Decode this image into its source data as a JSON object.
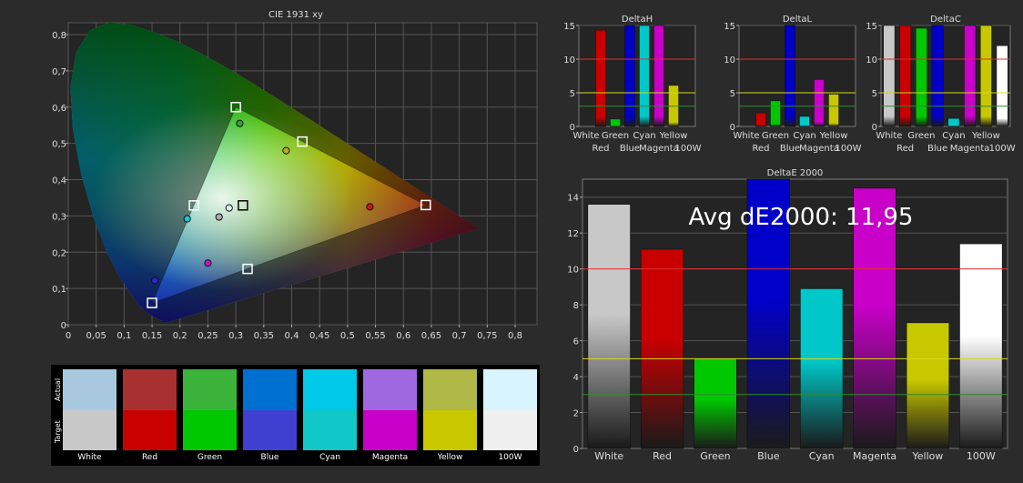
{
  "colors": {
    "background": "#2b2b2b",
    "plot_bg": "#242424",
    "grid": "#555555",
    "red_line": "#e03030",
    "yellow_line": "#d8d820",
    "green_line": "#2e8b2e"
  },
  "chart_data": [
    {
      "id": "cie",
      "type": "scatter",
      "title": "CIE 1931 xy",
      "xlim": [
        0,
        0.8
      ],
      "ylim": [
        0,
        0.8
      ],
      "x_ticks": [
        "0",
        "0,05",
        "0,1",
        "0,15",
        "0,2",
        "0,25",
        "0,3",
        "0,35",
        "0,4",
        "0,45",
        "0,5",
        "0,55",
        "0,6",
        "0,65",
        "0,7",
        "0,75",
        "0,8"
      ],
      "y_ticks": [
        "0",
        "0,1",
        "0,2",
        "0,3",
        "0,4",
        "0,5",
        "0,6",
        "0,7",
        "0,8"
      ],
      "target_points": [
        {
          "x": 0.64,
          "y": 0.33
        },
        {
          "x": 0.3,
          "y": 0.6
        },
        {
          "x": 0.15,
          "y": 0.06
        },
        {
          "x": 0.225,
          "y": 0.329
        },
        {
          "x": 0.321,
          "y": 0.154
        },
        {
          "x": 0.419,
          "y": 0.505
        },
        {
          "x": 0.3127,
          "y": 0.329
        }
      ],
      "measured_points": [
        {
          "x": 0.54,
          "y": 0.325,
          "color": "#c81818"
        },
        {
          "x": 0.307,
          "y": 0.555,
          "color": "#28a828"
        },
        {
          "x": 0.155,
          "y": 0.122,
          "color": "#2a2ad0"
        },
        {
          "x": 0.213,
          "y": 0.292,
          "color": "#18c8c8"
        },
        {
          "x": 0.25,
          "y": 0.17,
          "color": "#c018c0"
        },
        {
          "x": 0.39,
          "y": 0.48,
          "color": "#b0b020"
        },
        {
          "x": 0.27,
          "y": 0.297,
          "color": "#aaaaaa"
        },
        {
          "x": 0.288,
          "y": 0.322,
          "color": "#e0f0ff"
        }
      ]
    },
    {
      "id": "deltah",
      "type": "bar",
      "title": "DeltaH",
      "ylim": [
        0,
        15
      ],
      "y_ticks": [
        "0",
        "5",
        "10",
        "15"
      ],
      "categories_row1": [
        "White",
        "Green",
        "Cyan",
        "Yellow"
      ],
      "categories_row2": [
        "Red",
        "Blue",
        "Magenta",
        "100W"
      ],
      "values": [
        0,
        14.3,
        1.1,
        15,
        15,
        15,
        6.1,
        0
      ],
      "bar_colors": [
        "#c8c8c8",
        "#c80000",
        "#00c800",
        "#0000c8",
        "#00c8c8",
        "#c800c8",
        "#c8c800",
        "#ffffff"
      ],
      "thresholds": [
        10,
        5,
        3
      ]
    },
    {
      "id": "deltal",
      "type": "bar",
      "title": "DeltaL",
      "ylim": [
        0,
        15
      ],
      "y_ticks": [
        "0",
        "5",
        "10",
        "15"
      ],
      "categories_row1": [
        "White",
        "Green",
        "Cyan",
        "Yellow"
      ],
      "categories_row2": [
        "Red",
        "Blue",
        "Magenta",
        "100W"
      ],
      "values": [
        0,
        2,
        3.8,
        15,
        1.5,
        7,
        4.8,
        0
      ],
      "bar_colors": [
        "#c8c8c8",
        "#c80000",
        "#00c800",
        "#0000c8",
        "#00c8c8",
        "#c800c8",
        "#c8c800",
        "#ffffff"
      ],
      "thresholds": [
        10,
        5,
        3
      ]
    },
    {
      "id": "deltac",
      "type": "bar",
      "title": "DeltaC",
      "ylim": [
        0,
        15
      ],
      "y_ticks": [
        "0",
        "5",
        "10",
        "15"
      ],
      "categories_row1": [
        "White",
        "Green",
        "Cyan",
        "Yellow"
      ],
      "categories_row2": [
        "Red",
        "Blue",
        "Magenta",
        "100W"
      ],
      "values": [
        15,
        15,
        14.6,
        15,
        1.2,
        15,
        15,
        12
      ],
      "bar_colors": [
        "#c8c8c8",
        "#c80000",
        "#00c800",
        "#0000c8",
        "#00c8c8",
        "#c800c8",
        "#c8c800",
        "#ffffff"
      ],
      "thresholds": [
        10,
        5,
        3
      ]
    },
    {
      "id": "deltae",
      "type": "bar",
      "title": "DeltaE 2000",
      "annotation": "Avg dE2000: 11,95",
      "ylim": [
        0,
        15
      ],
      "y_ticks": [
        "0",
        "2",
        "4",
        "6",
        "8",
        "10",
        "12",
        "14"
      ],
      "categories": [
        "White",
        "Red",
        "Green",
        "Blue",
        "Cyan",
        "Magenta",
        "Yellow",
        "100W"
      ],
      "values": [
        13.6,
        11.1,
        5.0,
        15.0,
        8.9,
        14.5,
        7.0,
        11.4
      ],
      "bar_colors": [
        "#c8c8c8",
        "#c80000",
        "#00c800",
        "#0000c8",
        "#00c8c8",
        "#c800c8",
        "#c8c800",
        "#ffffff"
      ],
      "thresholds": [
        10,
        5,
        3
      ]
    }
  ],
  "swatches": {
    "actual_label": "Actual",
    "target_label": "Target",
    "items": [
      {
        "name": "White",
        "actual": "#a8c8e0",
        "target": "#c8c8c8"
      },
      {
        "name": "Red",
        "actual": "#a83030",
        "target": "#c80000"
      },
      {
        "name": "Green",
        "actual": "#3cb43c",
        "target": "#00c800"
      },
      {
        "name": "Blue",
        "actual": "#0070d0",
        "target": "#4040d0"
      },
      {
        "name": "Cyan",
        "actual": "#00c8e8",
        "target": "#10c8c8"
      },
      {
        "name": "Magenta",
        "actual": "#a068e0",
        "target": "#c800c8"
      },
      {
        "name": "Yellow",
        "actual": "#b0b848",
        "target": "#c8c800"
      },
      {
        "name": "100W",
        "actual": "#d8f4ff",
        "target": "#f0f0f0"
      }
    ]
  }
}
